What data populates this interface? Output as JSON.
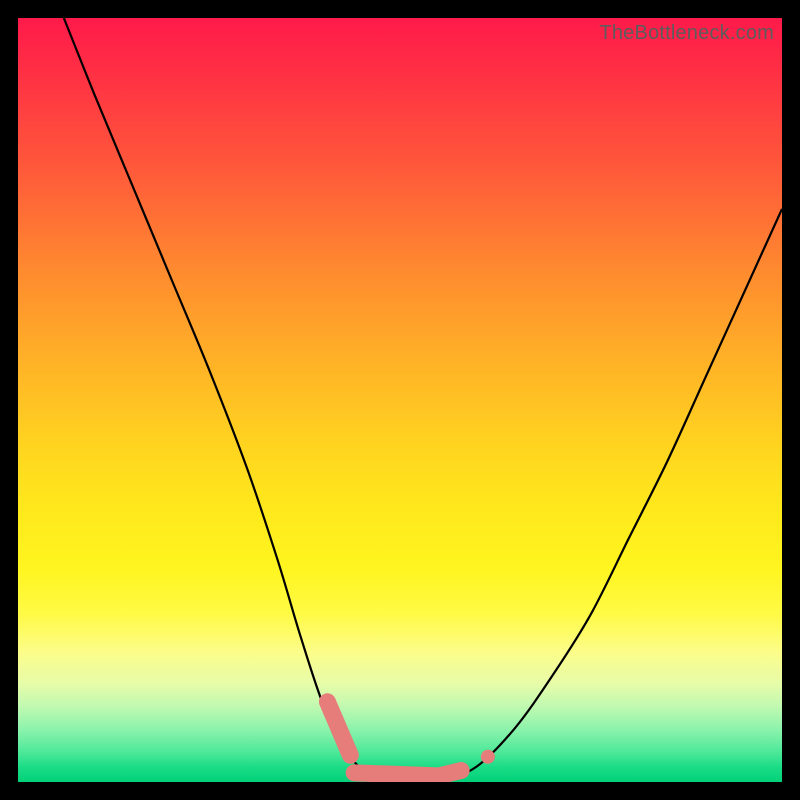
{
  "watermark": "TheBottleneck.com",
  "colors": {
    "marker": "#e67d7a",
    "curve": "#000000",
    "background_top": "#ff1a4a",
    "background_bottom": "#00d17a",
    "frame": "#000000"
  },
  "chart_data": {
    "type": "line",
    "title": "",
    "xlabel": "",
    "ylabel": "",
    "xlim": [
      0,
      100
    ],
    "ylim": [
      0,
      100
    ],
    "grid": false,
    "legend": false,
    "series": [
      {
        "name": "bottleneck-curve",
        "x": [
          6,
          10,
          15,
          20,
          25,
          30,
          34,
          37,
          40,
          43,
          46,
          50,
          55,
          60,
          65,
          70,
          75,
          80,
          85,
          90,
          95,
          100
        ],
        "values": [
          100,
          90,
          78,
          66,
          54,
          41,
          29,
          19,
          10,
          4,
          1,
          0,
          0,
          2,
          7,
          14,
          22,
          32,
          42,
          53,
          64,
          75
        ]
      }
    ],
    "markers": [
      {
        "kind": "segment",
        "x0": 40.5,
        "y0": 10.5,
        "x1": 43.5,
        "y1": 3.5
      },
      {
        "kind": "segment",
        "x0": 44.0,
        "y0": 1.2,
        "x1": 55.0,
        "y1": 0.8
      },
      {
        "kind": "segment",
        "x0": 55.5,
        "y0": 0.9,
        "x1": 58.0,
        "y1": 1.5
      },
      {
        "kind": "dot",
        "x": 61.5,
        "y": 3.3,
        "r": 7
      }
    ],
    "annotations": []
  }
}
